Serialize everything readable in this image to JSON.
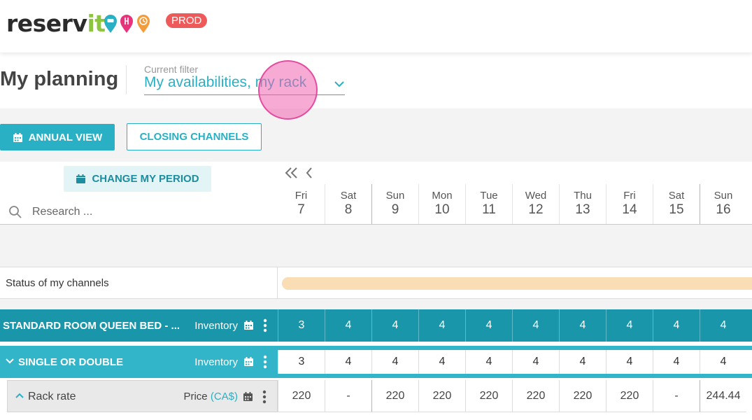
{
  "header": {
    "logo_main": "reserv",
    "logo_accent": "it",
    "env_badge": "PROD",
    "colors": {
      "brand_dark": "#2b2b2b",
      "brand_green": "#8cc63f",
      "pin_teal": "#29b0c5",
      "pin_pink": "#e6337a",
      "pin_orange": "#f39c3c",
      "badge": "#ee5a5a"
    }
  },
  "page": {
    "title": "My planning",
    "filter_label": "Current filter",
    "filter_value": "My availabilities, my rack"
  },
  "toolbar": {
    "annual_view_label": "ANNUAL VIEW",
    "closing_channels_label": "CLOSING CHANNELS"
  },
  "planning": {
    "change_period_label": "CHANGE MY PERIOD",
    "search_placeholder": "Research ...",
    "days": [
      {
        "name": "Fri",
        "num": "7"
      },
      {
        "name": "Sat",
        "num": "8"
      },
      {
        "name": "Sun",
        "num": "9"
      },
      {
        "name": "Mon",
        "num": "10"
      },
      {
        "name": "Tue",
        "num": "11"
      },
      {
        "name": "Wed",
        "num": "12"
      },
      {
        "name": "Thu",
        "num": "13"
      },
      {
        "name": "Fri",
        "num": "14"
      },
      {
        "name": "Sat",
        "num": "15"
      },
      {
        "name": "Sun",
        "num": "16"
      }
    ],
    "status_label": "Status of my channels",
    "status_color": "#f9ddb4",
    "rows": [
      {
        "name": "STANDARD ROOM QUEEN BED - ...",
        "type": "Inventory",
        "values": [
          "3",
          "4",
          "4",
          "4",
          "4",
          "4",
          "4",
          "4",
          "4",
          "4"
        ]
      },
      {
        "name": "SINGLE OR DOUBLE",
        "type": "Inventory",
        "values": [
          "3",
          "4",
          "4",
          "4",
          "4",
          "4",
          "4",
          "4",
          "4",
          "4"
        ]
      },
      {
        "name": "Rack rate",
        "type": "Price",
        "currency": "(CA$)",
        "values": [
          "220",
          "-",
          "220",
          "220",
          "220",
          "220",
          "220",
          "220",
          "-",
          "244.44"
        ]
      }
    ]
  },
  "theme": {
    "accent": "#29b0c5",
    "room_row": "#1a96ab",
    "subroom_row": "#32b5c9",
    "click_marker": "#f064af"
  }
}
